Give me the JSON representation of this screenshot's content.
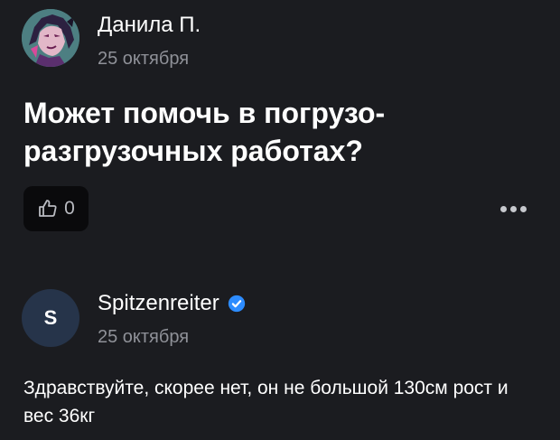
{
  "question": {
    "author": "Данила П.",
    "date": "25 октября",
    "title": "Может помочь в погрузо-разгрузочных работах?",
    "likes": "0"
  },
  "answer": {
    "author": "Spitzenreiter",
    "avatar_letter": "S",
    "date": "25 октября",
    "text": "Здравствуйте, скорее нет, он не большой 130см рост и вес 36кг"
  },
  "icons": {
    "like": "thumbs-up-icon",
    "more": "more-horizontal-icon",
    "verified": "verified-badge-icon"
  },
  "colors": {
    "background": "#1b1c20",
    "verified": "#2d8cff",
    "secondary_text": "#8f9198"
  }
}
